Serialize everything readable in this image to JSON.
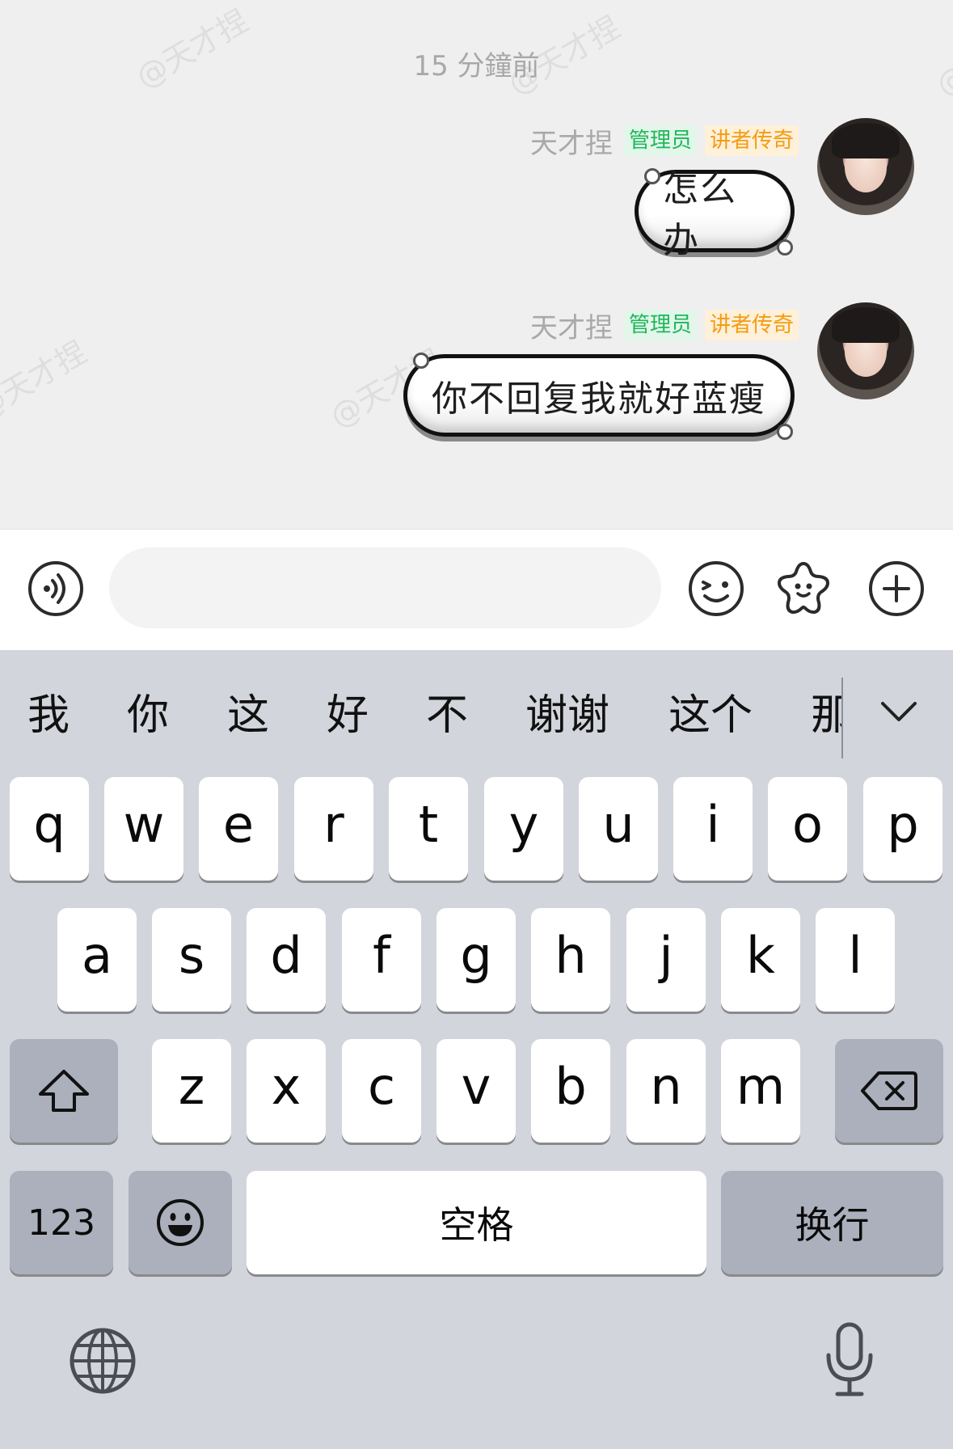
{
  "chat": {
    "timestamp": "15 分鐘前",
    "watermark": "@天才捏",
    "messages": [
      {
        "sender": "天才捏",
        "badges": [
          "管理员",
          "讲者传奇"
        ],
        "text": "怎么办"
      },
      {
        "sender": "天才捏",
        "badges": [
          "管理员",
          "讲者传奇"
        ],
        "text": "你不回复我就好蓝瘦"
      }
    ]
  },
  "input_bar": {
    "voice_icon": "voice-wave-icon",
    "input_value": "",
    "emoji_icon": "wink-face-icon",
    "sticker_icon": "star-face-icon",
    "plus_icon": "plus-circle-icon"
  },
  "keyboard": {
    "candidates": [
      "我",
      "你",
      "这",
      "好",
      "不",
      "谢谢",
      "这个",
      "那"
    ],
    "expand_icon": "chevron-down-icon",
    "row1": [
      "q",
      "w",
      "e",
      "r",
      "t",
      "y",
      "u",
      "i",
      "o",
      "p"
    ],
    "row2": [
      "a",
      "s",
      "d",
      "f",
      "g",
      "h",
      "j",
      "k",
      "l"
    ],
    "row3": [
      "z",
      "x",
      "c",
      "v",
      "b",
      "n",
      "m"
    ],
    "shift_icon": "shift-arrow-icon",
    "delete_icon": "backspace-icon",
    "numbers_label": "123",
    "emoji_icon": "smiley-icon",
    "space_label": "空格",
    "return_label": "换行",
    "globe_icon": "globe-icon",
    "mic_icon": "microphone-icon"
  }
}
